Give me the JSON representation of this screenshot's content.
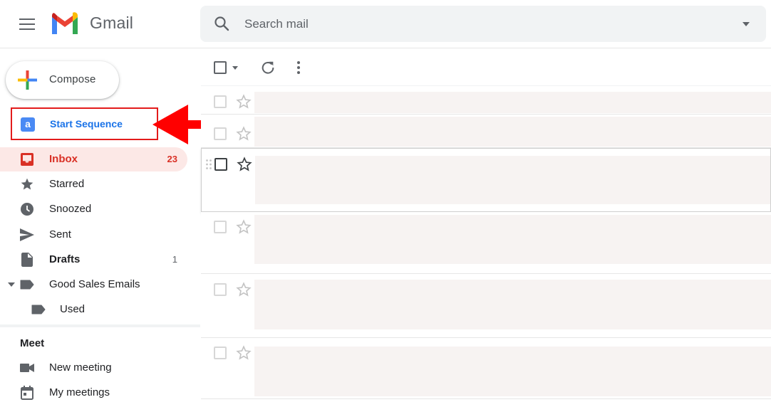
{
  "app": {
    "brand": "Gmail"
  },
  "search": {
    "placeholder": "Search mail"
  },
  "compose": {
    "label": "Compose"
  },
  "sequence": {
    "label": "Start Sequence",
    "badge": "a"
  },
  "nav": [
    {
      "label": "Inbox",
      "count": "23",
      "icon": "inbox-icon",
      "active": true
    },
    {
      "label": "Starred",
      "count": "",
      "icon": "star-icon"
    },
    {
      "label": "Snoozed",
      "count": "",
      "icon": "clock-icon"
    },
    {
      "label": "Sent",
      "count": "",
      "icon": "send-icon"
    },
    {
      "label": "Drafts",
      "count": "1",
      "icon": "draft-icon"
    },
    {
      "label": "Good Sales Emails",
      "count": "",
      "icon": "label-icon"
    },
    {
      "label": "Used",
      "count": "",
      "icon": "label-icon"
    }
  ],
  "meet": {
    "heading": "Meet",
    "items": [
      {
        "label": "New meeting",
        "icon": "video-icon"
      },
      {
        "label": "My meetings",
        "icon": "calendar-icon"
      }
    ]
  },
  "colors": {
    "accent_red": "#d93025",
    "highlight_box": "#e31b1b",
    "link_blue": "#1a73e8",
    "active_bg": "#fce8e6"
  }
}
